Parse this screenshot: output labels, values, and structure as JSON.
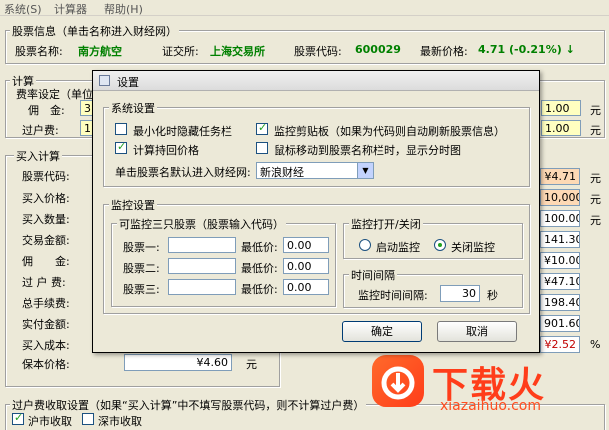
{
  "menu": [
    "系统(S)",
    "计算器",
    "帮助(H)"
  ],
  "stock_info": {
    "title": "股票信息（单击名称进入财经网）",
    "name_label": "股票名称:",
    "name_value": "南方航空",
    "exchange_label": "证交所:",
    "exchange_value": "上海交易所",
    "code_label": "股票代码:",
    "code_value": "600029",
    "price_label": "最新价格:",
    "price_value": "4.71 (-0.21%) ↓"
  },
  "calc": {
    "title": "计算",
    "fee_title": "费率设定（单位",
    "commission_label": "佣　金:",
    "commission_prefix": "3.",
    "transfer_label": "过户费:",
    "transfer_prefix": "1.",
    "right_fields": [
      "1.00",
      "1.00"
    ],
    "right_units": [
      "元",
      "元"
    ]
  },
  "buy": {
    "title": "买入计算",
    "labels": [
      "股票代码:",
      "买入价格:",
      "买入数量:",
      "交易金额:",
      "佣　　金:",
      "过 户 费:",
      "总手续费:",
      "实付金额:",
      "买入成本:",
      "保本价格:"
    ],
    "breakeven_value": "¥4.60",
    "breakeven_unit": "元"
  },
  "right_column": {
    "values": [
      "¥4.71",
      "10,000",
      "100.00",
      "141.30",
      "¥10.00",
      "¥47.10",
      "198.40",
      "901.60",
      "¥2.52"
    ],
    "units": [
      "元",
      "元",
      "元",
      "",
      "",
      "",
      "",
      "",
      "%"
    ]
  },
  "bottom": {
    "title": "过户费收取设置（如果“买入计算”中不填写股票代码，则不计算过户费）",
    "sh_label": "沪市收取",
    "sz_label": "深市收取"
  },
  "dialog": {
    "title": "设置",
    "system_group": "系统设置",
    "cb_minimize": "最小化时隐藏任务栏",
    "cb_clipboard": "监控剪贴板（如果为代码则自动刷新股票信息）",
    "cb_calc_return": "计算持回价格",
    "cb_hover": "鼠标移动到股票名称栏时，显示分时图",
    "default_site_label": "单击股票名默认进入财经网:",
    "default_site_value": "新浪财经",
    "monitor_group": "监控设置",
    "stocks_group": "可监控三只股票（股票输入代码）",
    "stock_labels": [
      "股票一:",
      "股票二:",
      "股票三:"
    ],
    "low_label": "最低价:",
    "low_values": [
      "0.00",
      "0.00",
      "0.00"
    ],
    "toggle_group": "监控打开/关闭",
    "rb_start": "启动监控",
    "rb_close": "关闭监控",
    "interval_group": "时间间隔",
    "interval_label": "监控时间间隔:",
    "interval_value": "30",
    "interval_unit": "秒",
    "ok": "确定",
    "cancel": "取消"
  },
  "watermark": {
    "text": "下载火",
    "url": "xiazaihuo.com"
  },
  "colors": {
    "accent_green": "#008000",
    "price_orange": "#fdd9b5",
    "watermark": "#ff3d1a"
  }
}
